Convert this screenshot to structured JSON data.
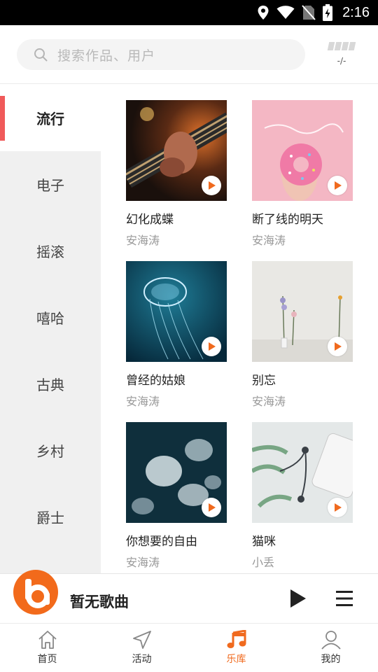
{
  "status_bar": {
    "time": "2:16",
    "icons": [
      "location-icon",
      "wifi-icon",
      "no-sim-icon",
      "battery-charging-icon"
    ]
  },
  "header": {
    "search_placeholder": "搜索作品、用户",
    "signal_text": "-/-"
  },
  "categories": [
    {
      "label": "流行",
      "active": true
    },
    {
      "label": "电子",
      "active": false
    },
    {
      "label": "摇滚",
      "active": false
    },
    {
      "label": "嘻哈",
      "active": false
    },
    {
      "label": "古典",
      "active": false
    },
    {
      "label": "乡村",
      "active": false
    },
    {
      "label": "爵士",
      "active": false
    }
  ],
  "songs": [
    {
      "title": "幻化成蝶",
      "artist": "安海涛",
      "cover": "guitar-photo"
    },
    {
      "title": "断了线的明天",
      "artist": "安海涛",
      "cover": "donut-photo"
    },
    {
      "title": "曾经的姑娘",
      "artist": "安海涛",
      "cover": "jellyfish-photo"
    },
    {
      "title": "别忘",
      "artist": "安海涛",
      "cover": "dried-flowers-photo"
    },
    {
      "title": "你想要的自由",
      "artist": "安海涛",
      "cover": "jellyfish-swarm-photo"
    },
    {
      "title": "猫咪",
      "artist": "小丢",
      "cover": "earphones-photo"
    }
  ],
  "player": {
    "title": "暂无歌曲"
  },
  "nav": [
    {
      "label": "首页",
      "icon": "home-icon",
      "active": false
    },
    {
      "label": "活动",
      "icon": "navigation-icon",
      "active": false
    },
    {
      "label": "乐库",
      "icon": "music-note-icon",
      "active": true
    },
    {
      "label": "我的",
      "icon": "user-icon",
      "active": false
    }
  ],
  "colors": {
    "accent": "#f06a1e",
    "indicator": "#f05a5a",
    "sidebar_bg": "#f0f0f0"
  }
}
